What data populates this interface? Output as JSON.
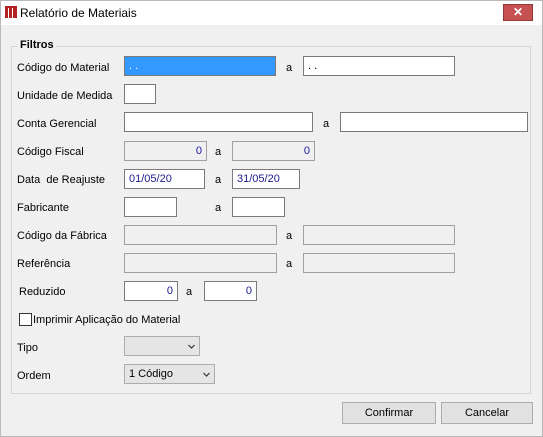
{
  "window": {
    "title": "Relatório de Materiais",
    "close_glyph": "✕"
  },
  "group": {
    "title": "Filtros"
  },
  "fields": {
    "codigo_material": {
      "label": "Código do Material",
      "from": " .  . ",
      "to": " .  . "
    },
    "unidade_medida": {
      "label": "Unidade de Medida",
      "value": ""
    },
    "conta_gerencial": {
      "label": "Conta Gerencial",
      "from": "",
      "to": ""
    },
    "codigo_fiscal": {
      "label": "Código Fiscal",
      "from": "0",
      "to": "0"
    },
    "data_reajuste": {
      "label": "Data  de Reajuste",
      "from": "01/05/20",
      "to": "31/05/20"
    },
    "fabricante": {
      "label": "Fabricante",
      "from": "",
      "to": ""
    },
    "codigo_fabrica": {
      "label": "Código da Fábrica",
      "from": "",
      "to": ""
    },
    "referencia": {
      "label": "Referência",
      "from": "",
      "to": ""
    },
    "reduzido": {
      "label": "Reduzido",
      "from": "0",
      "to": "0"
    },
    "range_separator": "a"
  },
  "checkbox_imprimir": {
    "label": "Imprimir Aplicação do Material",
    "checked": false
  },
  "tipo": {
    "label": "Tipo",
    "value": ""
  },
  "ordem": {
    "label": "Ordem",
    "value": "1 Código"
  },
  "buttons": {
    "confirmar": "Confirmar",
    "cancelar": "Cancelar"
  },
  "colors": {
    "selection": "#3399ff",
    "close": "#c75050",
    "icon": "#b22222"
  },
  "icons": {
    "app": "app-icon",
    "close": "close-icon",
    "dropdown": "chevron-down-icon"
  }
}
